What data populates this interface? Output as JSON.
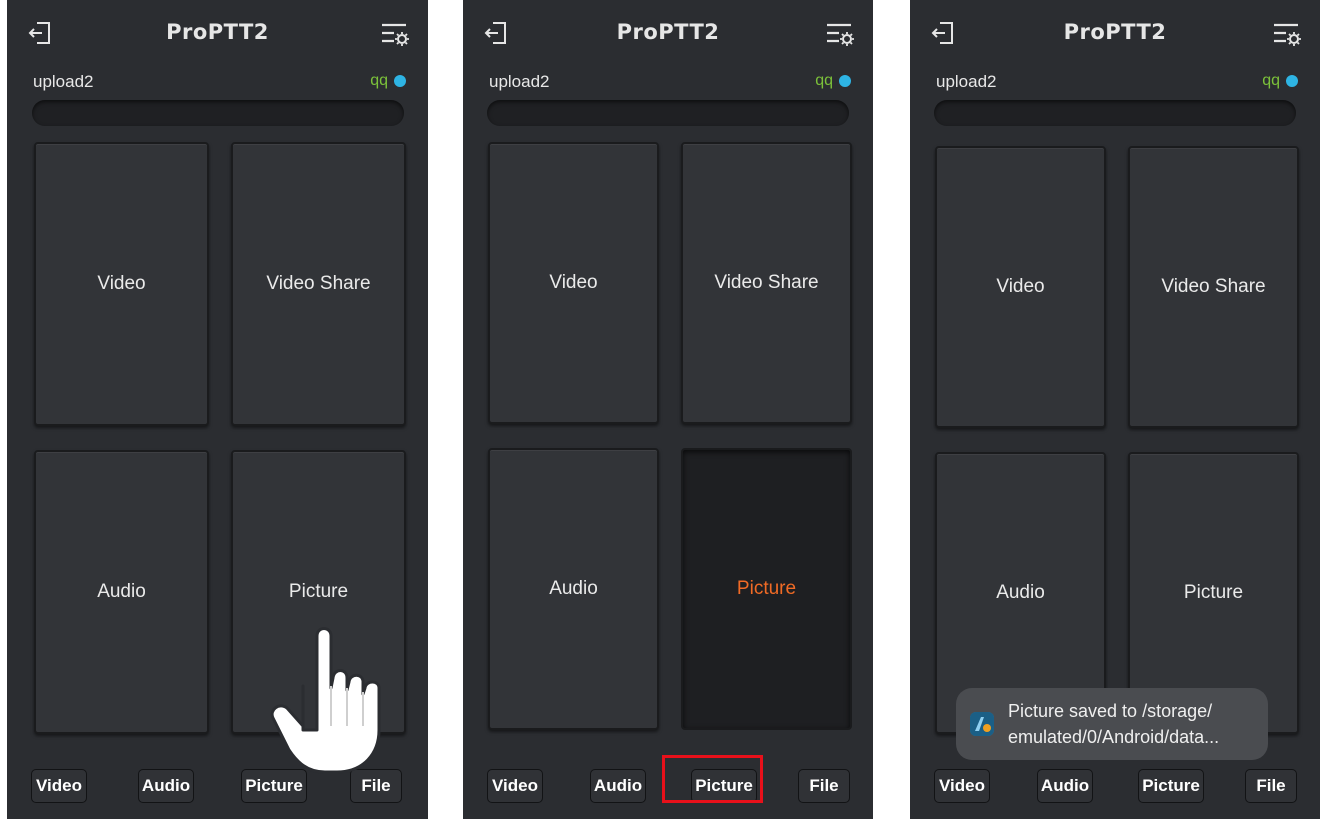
{
  "screens": [
    {
      "app_title": "ProPTT2",
      "user": "upload2",
      "presence": "qq",
      "tiles": [
        "Video",
        "Video Share",
        "Audio",
        "Picture"
      ],
      "bottom_buttons": [
        "Video",
        "Audio",
        "Picture",
        "File"
      ]
    },
    {
      "app_title": "ProPTT2",
      "user": "upload2",
      "presence": "qq",
      "tiles": [
        "Video",
        "Video Share",
        "Audio",
        "Picture"
      ],
      "bottom_buttons": [
        "Video",
        "Audio",
        "Picture",
        "File"
      ]
    },
    {
      "app_title": "ProPTT2",
      "user": "upload2",
      "presence": "qq",
      "tiles": [
        "Video",
        "Video Share",
        "Audio",
        "Picture"
      ],
      "bottom_buttons": [
        "Video",
        "Audio",
        "Picture",
        "File"
      ],
      "toast": {
        "line1": "Picture saved to /storage/",
        "line2": "emulated/0/Android/data..."
      }
    }
  ],
  "colors": {
    "background": "#2b2d31",
    "tile": "#323438",
    "pressed_text": "#f06a25",
    "presence_text": "#7cc23a",
    "presence_dot": "#2eb4e4",
    "highlight": "#e8101a"
  },
  "icons": [
    "back-icon",
    "settings-icon",
    "pointing-hand-icon",
    "app-icon"
  ]
}
